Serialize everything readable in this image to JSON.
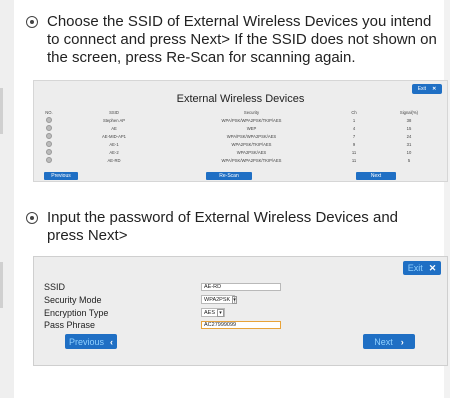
{
  "step1": {
    "text": "Choose the SSID of External Wireless Devices you intend to connect and press Next> If the SSID does not shown on the screen, press Re-Scan for scanning again."
  },
  "scan_panel": {
    "exit_label": "Exit",
    "title": "External Wireless Devices",
    "columns": [
      "NO.",
      "SSID",
      "Security",
      "Ch",
      "Signal(%)"
    ],
    "rows": [
      {
        "ssid": "Stephen AP",
        "security": "WPA/PSK/WPA2PSK/TKIP/AES",
        "ch": "1",
        "signal": "38"
      },
      {
        "ssid": "AE",
        "security": "WEP",
        "ch": "4",
        "signal": "15"
      },
      {
        "ssid": "AE-MID-AP1",
        "security": "WPA/PSK/WPA2PSK/AES",
        "ch": "7",
        "signal": "24"
      },
      {
        "ssid": "AE-1",
        "security": "WPA2PSK/TKIP/AES",
        "ch": "9",
        "signal": "31"
      },
      {
        "ssid": "AE-2",
        "security": "WPA2PSK/AES",
        "ch": "11",
        "signal": "10"
      },
      {
        "ssid": "AE-RD",
        "security": "WPA/PSK/WPA2PSK/TKIP/AES",
        "ch": "11",
        "signal": "5"
      }
    ],
    "previous_label": "Previous",
    "rescan_label": "Re-Scan",
    "next_label": "Next"
  },
  "step2": {
    "text": "Input the password of External Wireless Devices and press Next>"
  },
  "password_panel": {
    "exit_label": "Exit",
    "ssid_label": "SSID",
    "ssid_value": "AE-RD",
    "security_mode_label": "Security Mode",
    "security_mode_value": "WPA2PSK",
    "encryption_label": "Encryption Type",
    "encryption_value": "AES",
    "pass_phrase_label": "Pass Phrase",
    "pass_phrase_value": "AC27999099",
    "previous_label": "Previous",
    "next_label": "Next"
  },
  "colors": {
    "accent": "#1f6fc4",
    "panel_bg": "#ededed",
    "focus_border": "#e8a33a"
  }
}
